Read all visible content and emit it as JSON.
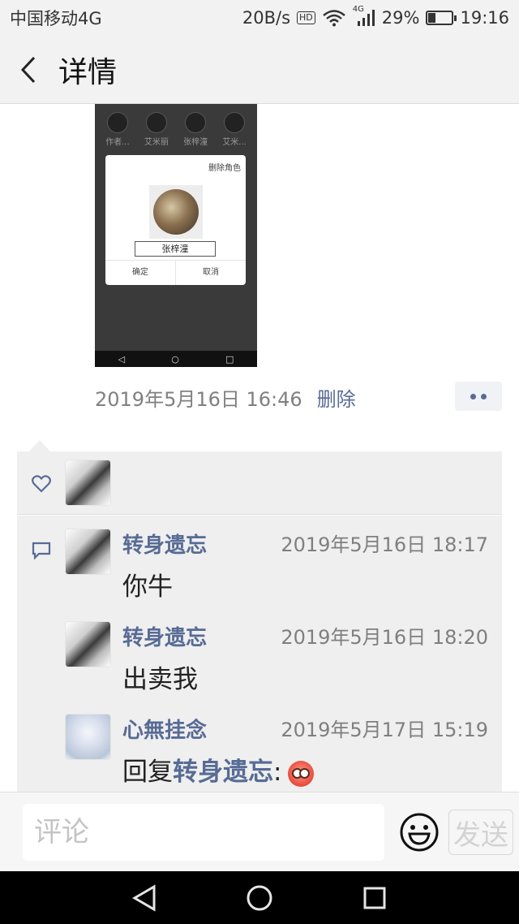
{
  "status_bar": {
    "carrier": "中国移动4G",
    "speed": "20B/s",
    "hd": "HD",
    "network": "4G",
    "battery": "29%",
    "battery_level": 0.29,
    "time": "19:16"
  },
  "header": {
    "title": "详情"
  },
  "post_image": {
    "avatar_labels": [
      "作者...",
      "艾米丽",
      "张梓潼",
      "艾米..."
    ],
    "delete_role": "删除角色",
    "name_field": "张梓潼",
    "confirm": "确定",
    "cancel": "取消",
    "nav": [
      "◁",
      "○",
      "□"
    ]
  },
  "post_meta": {
    "time": "2019年5月16日 16:46",
    "delete": "删除"
  },
  "comments": [
    {
      "name": "转身遗忘",
      "time": "2019年5月16日 18:17",
      "text": "你牛"
    },
    {
      "name": "转身遗忘",
      "time": "2019年5月16日 18:20",
      "text": "出卖我"
    },
    {
      "name": "心無挂念",
      "time": "2019年5月17日 15:19",
      "reply_prefix": "回复",
      "reply_to": "转身遗忘",
      "reply_suffix": ":",
      "emoji": "flushed-face"
    }
  ],
  "input": {
    "placeholder": "评论",
    "send": "发送"
  },
  "colors": {
    "link": "#576b95",
    "bg_comments": "#efefef"
  }
}
